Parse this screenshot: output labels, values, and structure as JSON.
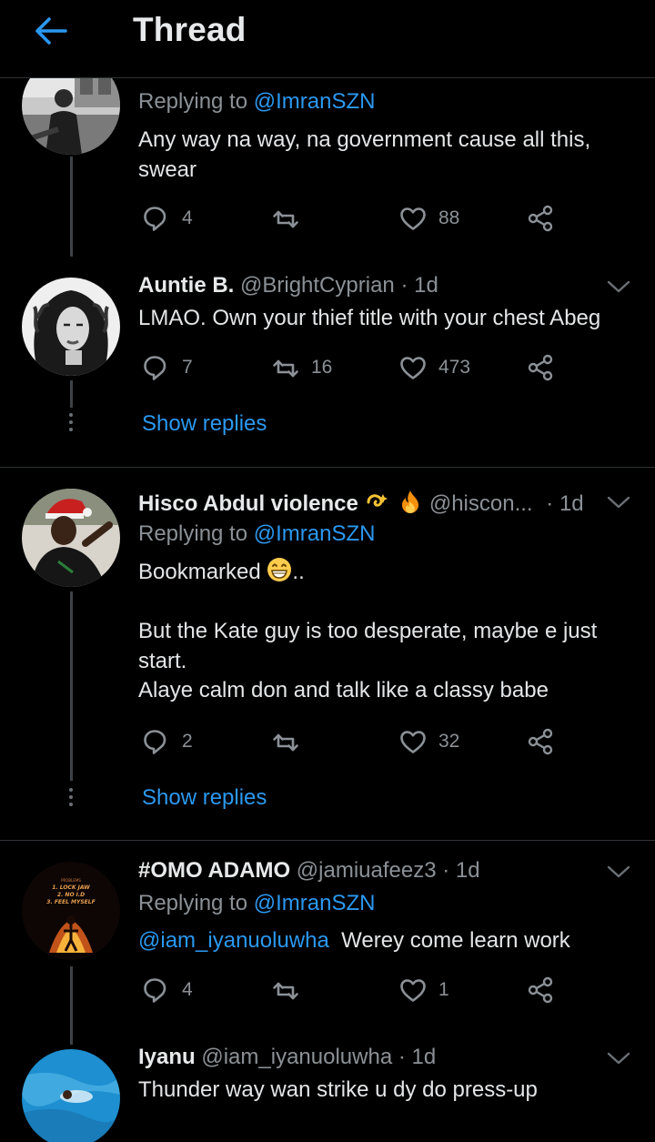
{
  "header": {
    "title": "Thread"
  },
  "tweets": [
    {
      "reply_prefix": "Replying to",
      "reply_to": "@ImranSZN",
      "text_lines": [
        "Any way na way, na government cause all this,",
        "swear"
      ],
      "replies": "4",
      "retweets": "",
      "likes": "88"
    },
    {
      "name": "Auntie B.",
      "handle": "@BrightCyprian",
      "sep": "·",
      "time": "1d",
      "text": "LMAO. Own your thief title with your chest Abeg",
      "replies": "7",
      "retweets": "16",
      "likes": "473",
      "show_replies": "Show replies"
    },
    {
      "name": "Hisco Abdul violence",
      "handle": "@hiscon...",
      "sep": "·",
      "time": "1d",
      "reply_prefix": "Replying to",
      "reply_to": "@ImranSZN",
      "text_first": "Bookmarked",
      "text_first_tail": "..",
      "text_lines": [
        "But the Kate guy is too desperate, maybe e just",
        "start.",
        "Alaye calm don and talk like a classy babe"
      ],
      "replies": "2",
      "retweets": "",
      "likes": "32",
      "show_replies": "Show replies"
    },
    {
      "name": "#OMO ADAMO",
      "handle": "@jamiuafeez3",
      "sep": "·",
      "time": "1d",
      "reply_prefix": "Replying to",
      "reply_to": "@ImranSZN",
      "mention": "@iam_iyanuoluwha",
      "text": "Werey come learn work",
      "avatar_text": [
        "PROBLEMS",
        "1. LOCK JAW",
        "2. NO I.D",
        "3. FEEL MYSELF"
      ],
      "replies": "4",
      "retweets": "",
      "likes": "1"
    },
    {
      "name": "Iyanu",
      "handle": "@iam_iyanuoluwha",
      "sep": "·",
      "time": "1d",
      "text": "Thunder way wan strike u dy do press-up"
    }
  ],
  "colors": {
    "accent": "#2b98f0",
    "background": "#000000",
    "muted": "#8b9196",
    "text": "#e3e5e7"
  }
}
